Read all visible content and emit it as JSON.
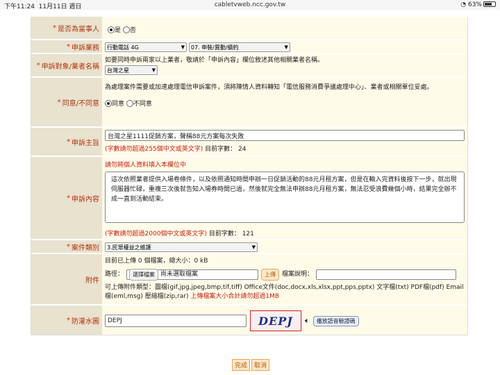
{
  "statusbar": {
    "time": "下午11:24",
    "date": "11月11日 週日",
    "url": "cabletvweb.ncc.gov.tw",
    "battery": "63%"
  },
  "is_party": {
    "label": "是否為當事人",
    "opt_yes": "是",
    "opt_no": "否",
    "selected": "是"
  },
  "business": {
    "label": "申訴業務",
    "service": "行動電話 4G",
    "category": "07. 申裝/異動/續約"
  },
  "target": {
    "label": "申訴對象/業者名稱",
    "note": "如要同時申訴兩家以上業者，敬請於「申訴內容」欄位敘述其他相關業者名稱。",
    "operator": "台灣之星"
  },
  "consent": {
    "label": "同意/不同意",
    "text": "為處理案件需要或加速處理電信申訴案件，須將陳情人資料轉知「電信服務消費爭議處理中心」、業者或相關單位妥處。",
    "agree": "同意",
    "disagree": "不同意",
    "selected": "同意"
  },
  "subject": {
    "label": "申訴主旨",
    "value": "台灣之星1111促銷方案，聲稱88元方案每次失敗",
    "limit": "(字數請勿超過255個中文或英文字)",
    "count_label": "目前字數：",
    "count": "24"
  },
  "content": {
    "label": "申訴內容",
    "warning": "請勿將個人資料填入本欄位中",
    "value": "這次依照業者提供入場卷條件，以及依照通知時間申辦一日促銷活動的88元月租方案，但是在輸入完資料後按下一步，就出現伺服器忙碌，重複三次後就告知入場券時間已過，然後就完全無法申辦88元月租方案，無法忍受浪費幾個小時，結果完全辦不成一直到活動結束。",
    "limit": "(字數請勿超過2000個中文或英文字)",
    "count_label": "目前字數：",
    "count": "121"
  },
  "case_type": {
    "label": "案件類別",
    "value": "3.民眾權益之維護"
  },
  "attach": {
    "label": "附件",
    "summary": "目前已上傳 0 個檔案，總大小：0 kB",
    "path_label": "路徑：",
    "choose": "選擇檔案",
    "no_file": "尚未選取檔案",
    "upload": "上傳",
    "desc_label": "檔案說明：",
    "types": "可上傳附件類型：圖檔(gif,jpg,jpeg,bmp,tif,tiff) Office文件(doc,docx,xls,xlsx,ppt,pps,pptx) 文字檔(txt) PDF檔(pdf) Email檔(eml,msg) 壓縮檔(zip,rar)",
    "size_limit": "上傳檔案大小合計請勿超過1MB"
  },
  "captcha": {
    "label": "防灌水圖",
    "value": "DEPJ",
    "image_text": "DEPJ",
    "audio": "播放語音驗證碼"
  },
  "footer": {
    "submit": "完成",
    "cancel": "取消"
  }
}
